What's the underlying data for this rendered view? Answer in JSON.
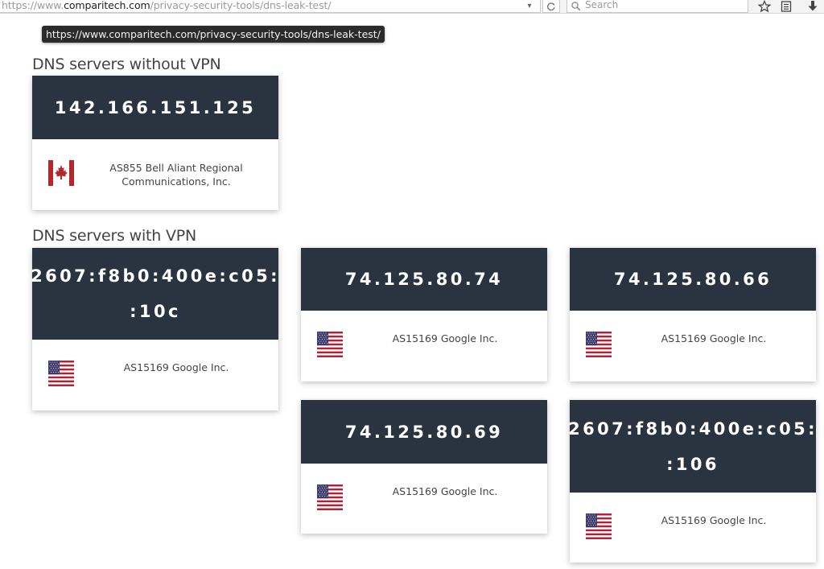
{
  "browser": {
    "url_prefix": "https://www.",
    "url_domain": "comparitech.com",
    "url_path": "/privacy-security-tools/dns-leak-test/",
    "search_placeholder": "Search",
    "tooltip": "https://www.comparitech.com/privacy-security-tools/dns-leak-test/"
  },
  "sections": {
    "without_vpn": "DNS servers without VPN",
    "with_vpn": "DNS servers with VPN"
  },
  "servers_without_vpn": [
    {
      "ip": "142.166.151.125",
      "isp": "AS855 Bell Aliant Regional Communications, Inc.",
      "country": "canada-flag"
    }
  ],
  "servers_with_vpn": [
    {
      "ip_line1": "2607:f8b0:400e:c05:",
      "ip_line2": ":10c",
      "isp": "AS15169 Google Inc.",
      "country": "usa-flag"
    },
    {
      "ip": "74.125.80.74",
      "isp": "AS15169 Google Inc.",
      "country": "usa-flag"
    },
    {
      "ip": "74.125.80.66",
      "isp": "AS15169 Google Inc.",
      "country": "usa-flag"
    },
    {
      "ip": "74.125.80.69",
      "isp": "AS15169 Google Inc.",
      "country": "usa-flag"
    },
    {
      "ip_line1": "2607:f8b0:400e:c05:",
      "ip_line2": ":106",
      "isp": "AS15169 Google Inc.",
      "country": "usa-flag"
    }
  ],
  "colors": {
    "card_header": "#2a3441",
    "canada_red": "#b3282d",
    "us_red": "#b22234",
    "us_blue": "#3c3b6e"
  }
}
